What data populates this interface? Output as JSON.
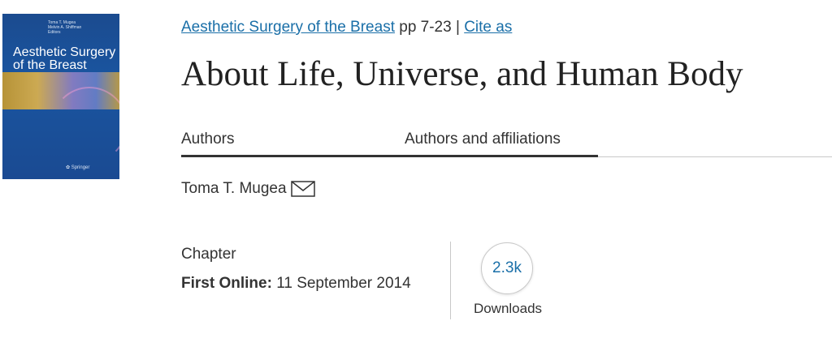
{
  "cover": {
    "editors": [
      "Toma T. Mugea",
      "Melvin A. Shiffman",
      "Editors"
    ],
    "title": "Aesthetic Surgery of the Breast",
    "publisher": "Springer",
    "colors": {
      "background": "#1a4f98",
      "band": "#e0b34a"
    }
  },
  "breadcrumb": {
    "book_link": "Aesthetic Surgery of the Breast",
    "pages": "pp 7-23",
    "separator": "|",
    "cite_link": "Cite as"
  },
  "title": "About Life, Universe, and Human Body",
  "tabs": [
    {
      "label": "Authors",
      "active": true
    },
    {
      "label": "Authors and affiliations",
      "active": false
    }
  ],
  "author": {
    "name": "Toma T. Mugea",
    "icon": "mail-icon"
  },
  "meta": {
    "type": "Chapter",
    "first_online_label": "First Online:",
    "first_online_date": "11 September 2014"
  },
  "metrics": {
    "downloads_value": "2.3k",
    "downloads_label": "Downloads"
  },
  "colors": {
    "link": "#1a6fa8",
    "text": "#333333",
    "divider": "#c8c8c8"
  }
}
